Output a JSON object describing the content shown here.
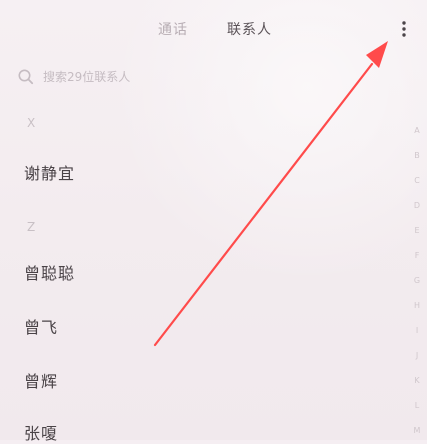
{
  "tabs": {
    "calls": "通话",
    "contacts": "联系人"
  },
  "search": {
    "placeholder": "搜索29位联系人"
  },
  "sections": {
    "x": "X",
    "z": "Z"
  },
  "contacts": [
    "谢静宜",
    "曾聪聪",
    "曾飞",
    "曾辉",
    "张嗄"
  ],
  "index_letters": [
    "A",
    "B",
    "C",
    "D",
    "E",
    "F",
    "G",
    "H",
    "I",
    "J",
    "K",
    "L",
    "M"
  ],
  "icons": {
    "search": "search-icon",
    "more": "more-vertical-icon",
    "annotation": "red-arrow-icon"
  },
  "colors": {
    "background": "#f5eef2",
    "annotation": "#ff4b4b"
  }
}
